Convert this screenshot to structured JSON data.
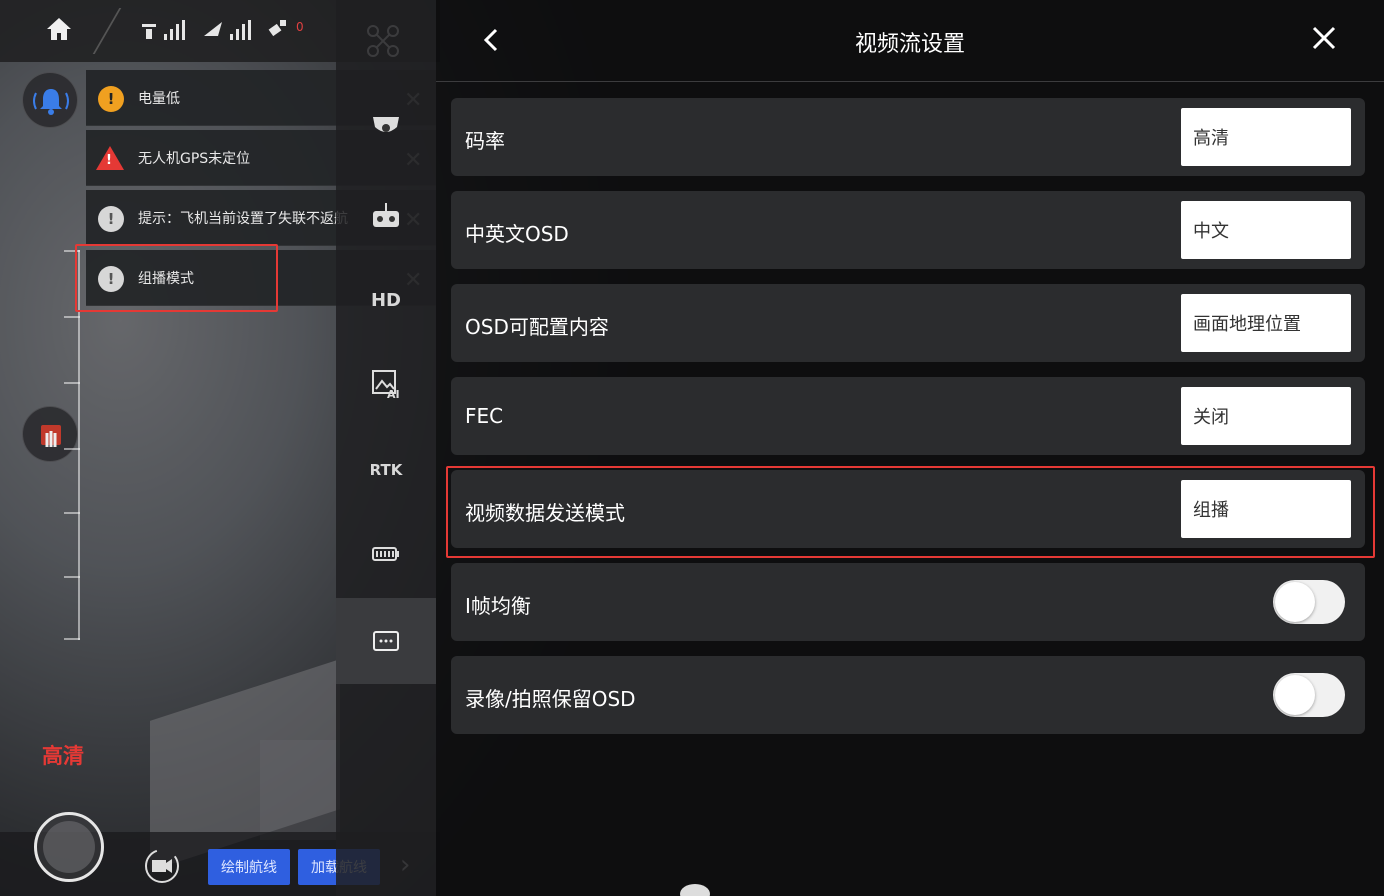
{
  "colors": {
    "accent_red": "#e53935",
    "panel_bg": "#0c0c0d",
    "row_bg": "#2b2c2e",
    "button_blue": "#2f5fe0",
    "warning_yellow": "#f0a020"
  },
  "topbar": {
    "red_count": "0"
  },
  "left": {
    "quality_label": "高清",
    "draw_route_button": "绘制航线",
    "load_route_button": "加载航线"
  },
  "notifications": [
    {
      "icon": "info-warning-icon",
      "text": "电量低"
    },
    {
      "icon": "alert-triangle-icon",
      "text": "无人机GPS未定位"
    },
    {
      "icon": "info-icon",
      "text": "提示：飞机当前设置了失联不返航"
    },
    {
      "icon": "info-icon",
      "text": "组播模式"
    }
  ],
  "nav": {
    "hd_label": "HD",
    "rtk_label": "RTK"
  },
  "panel": {
    "title": "视频流设置",
    "rows": [
      {
        "label": "码率",
        "value": "高清"
      },
      {
        "label": "中英文OSD",
        "value": "中文"
      },
      {
        "label": "OSD可配置内容",
        "value": "画面地理位置"
      },
      {
        "label": "FEC",
        "value": "关闭"
      },
      {
        "label": "视频数据发送模式",
        "value": "组播"
      },
      {
        "label": "I帧均衡",
        "toggle": false
      },
      {
        "label": "录像/拍照保留OSD",
        "toggle": false
      }
    ]
  }
}
